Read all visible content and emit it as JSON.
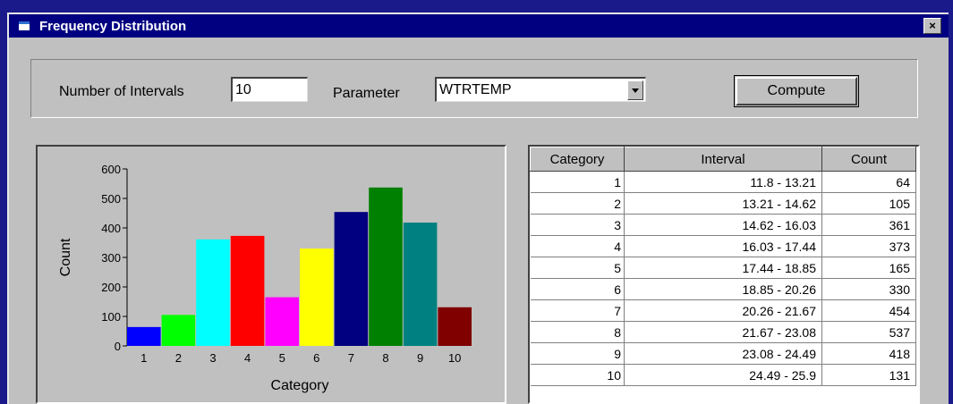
{
  "window": {
    "title": "Frequency Distribution",
    "close_symbol": "×"
  },
  "controls": {
    "intervals_label": "Number of Intervals",
    "intervals_value": "10",
    "parameter_label": "Parameter",
    "parameter_value": "WTRTEMP",
    "compute_label": "Compute"
  },
  "chart_data": {
    "type": "bar",
    "title": "",
    "xlabel": "Category",
    "ylabel": "Count",
    "ylim": [
      0,
      600
    ],
    "yticks": [
      "0",
      "100",
      "200",
      "300",
      "400",
      "500",
      "600"
    ],
    "categories": [
      "1",
      "2",
      "3",
      "4",
      "5",
      "6",
      "7",
      "8",
      "9",
      "10"
    ],
    "values": [
      64,
      105,
      361,
      373,
      165,
      330,
      454,
      537,
      418,
      131
    ],
    "colors": [
      "#0000ff",
      "#00ff00",
      "#00ffff",
      "#ff0000",
      "#ff00ff",
      "#ffff00",
      "#000080",
      "#008000",
      "#008080",
      "#800000"
    ],
    "grid": false,
    "legend": "none"
  },
  "table": {
    "headers": [
      "Category",
      "Interval",
      "Count"
    ],
    "rows": [
      [
        "1",
        "11.8 - 13.21",
        "64"
      ],
      [
        "2",
        "13.21 - 14.62",
        "105"
      ],
      [
        "3",
        "14.62 - 16.03",
        "361"
      ],
      [
        "4",
        "16.03 - 17.44",
        "373"
      ],
      [
        "5",
        "17.44 - 18.85",
        "165"
      ],
      [
        "6",
        "18.85 - 20.26",
        "330"
      ],
      [
        "7",
        "20.26 - 21.67",
        "454"
      ],
      [
        "8",
        "21.67 - 23.08",
        "537"
      ],
      [
        "9",
        "23.08 - 24.49",
        "418"
      ],
      [
        "10",
        "24.49 - 25.9",
        "131"
      ]
    ]
  }
}
